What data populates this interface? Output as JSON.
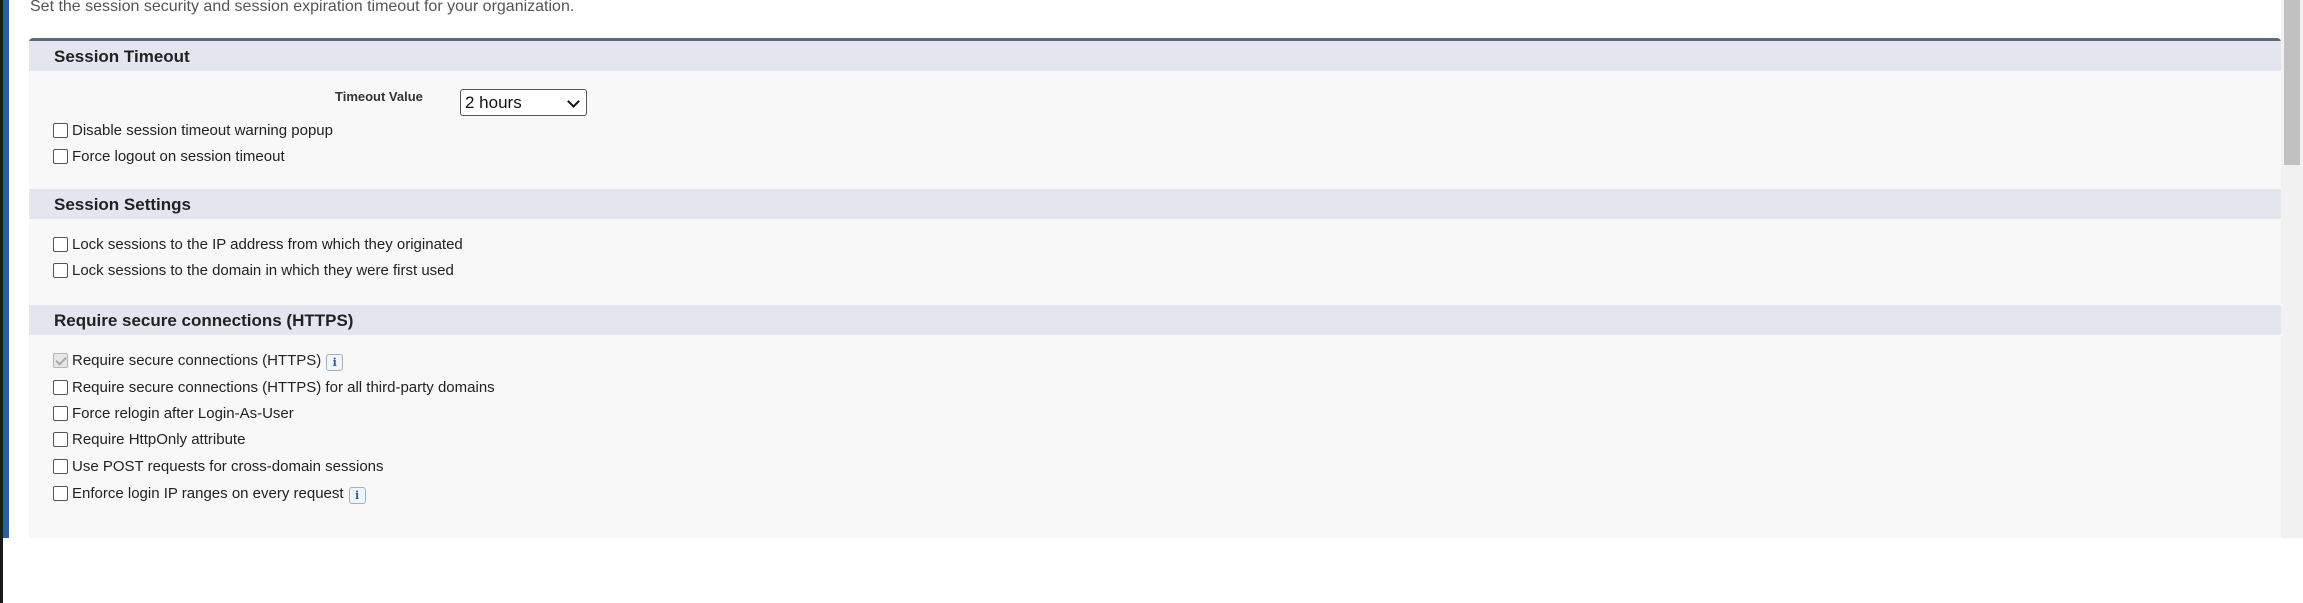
{
  "intro_text": "Set the session security and session expiration timeout for your organization.",
  "session_timeout": {
    "title": "Session Timeout",
    "timeout_label": "Timeout Value",
    "timeout_value": "2 hours",
    "options": [
      {
        "label": "Disable session timeout warning popup",
        "checked": false
      },
      {
        "label": "Force logout on session timeout",
        "checked": false
      }
    ]
  },
  "session_settings": {
    "title": "Session Settings",
    "options": [
      {
        "label": "Lock sessions to the IP address from which they originated",
        "checked": false
      },
      {
        "label": "Lock sessions to the domain in which they were first used",
        "checked": false
      }
    ]
  },
  "secure_connections": {
    "title": "Require secure connections (HTTPS)",
    "options": [
      {
        "label": "Require secure connections (HTTPS)",
        "checked": true,
        "disabled": true,
        "info_icon": true
      },
      {
        "label": "Require secure connections (HTTPS) for all third-party domains",
        "checked": false
      },
      {
        "label": "Force relogin after Login-As-User",
        "checked": false
      },
      {
        "label": "Require HttpOnly attribute",
        "checked": false
      },
      {
        "label": "Use POST requests for cross-domain sessions",
        "checked": false
      },
      {
        "label": "Enforce login IP ranges on every request",
        "checked": false,
        "info_icon": true
      }
    ]
  },
  "info_icon_glyph": "i",
  "colors": {
    "accent": "#2a5d9f",
    "section_header_bg": "#e3e6ef",
    "panel_bg": "#f8f8f8"
  }
}
